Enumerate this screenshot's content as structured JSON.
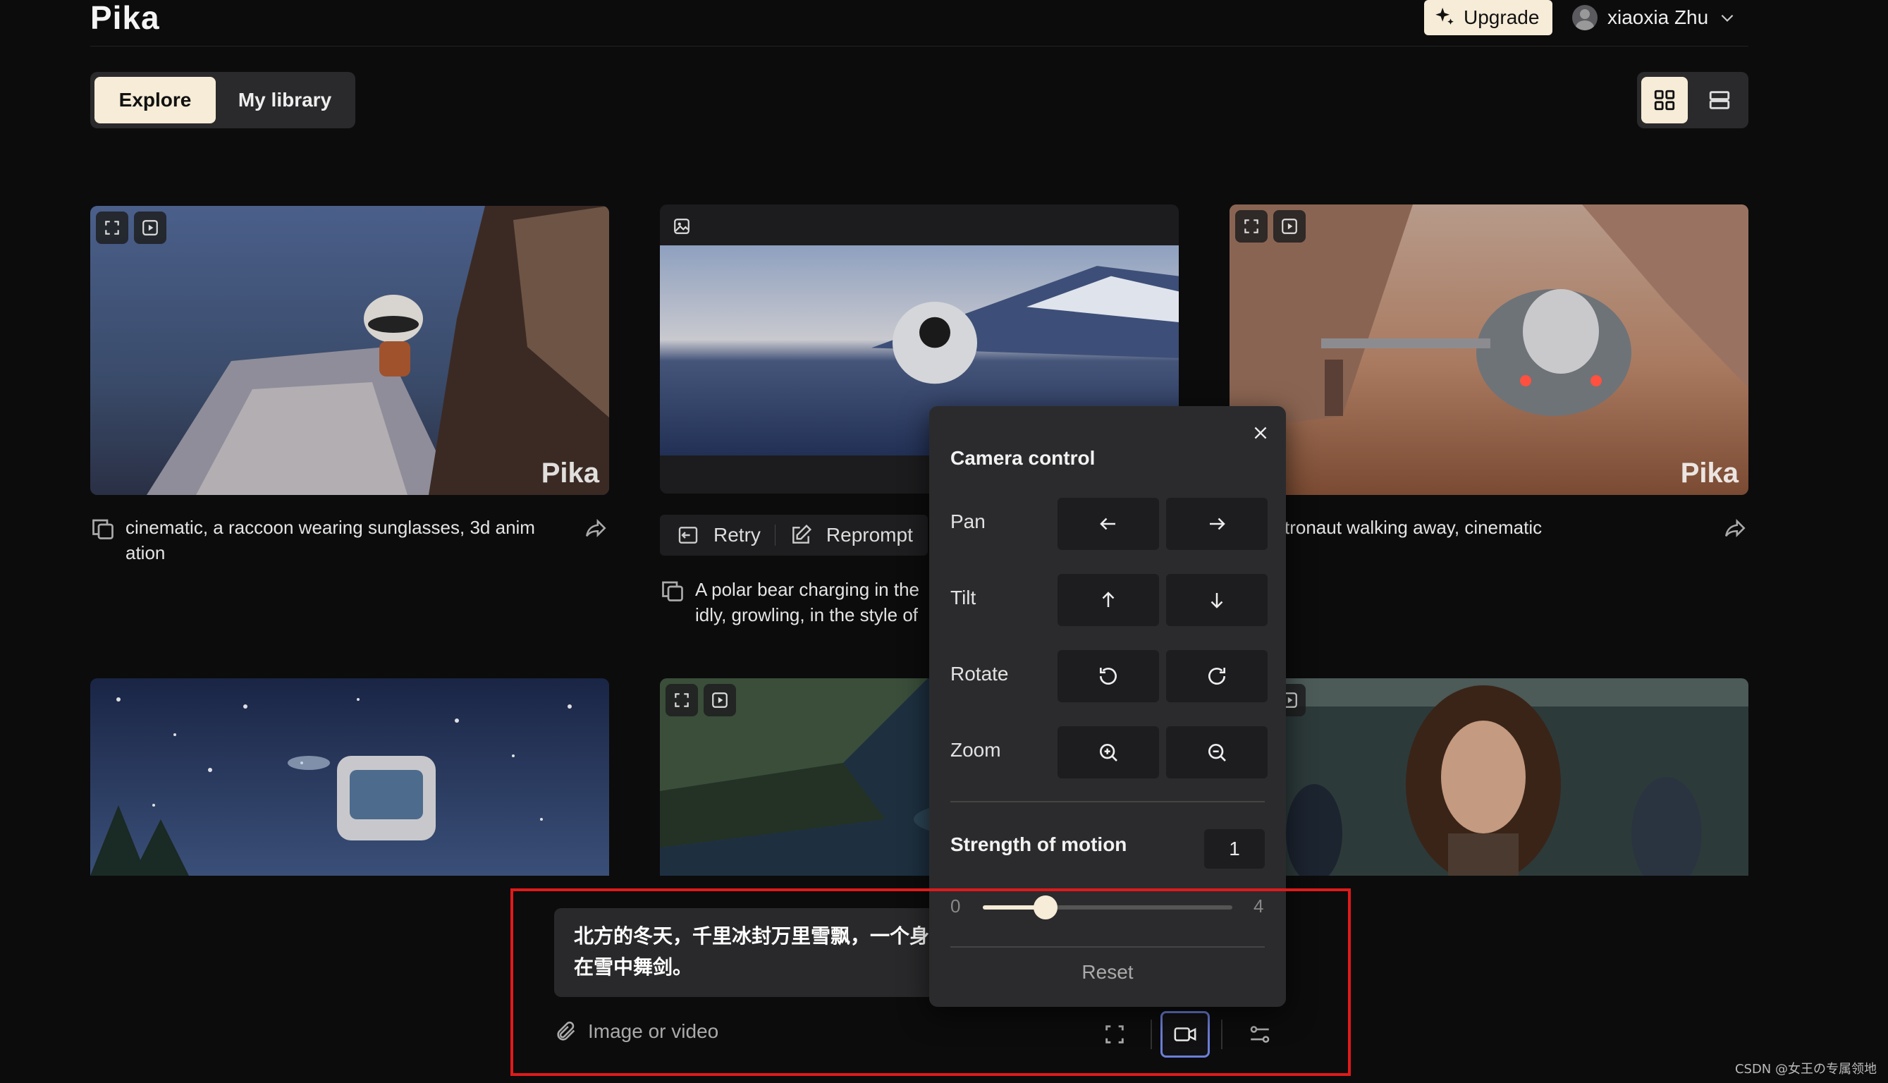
{
  "app": {
    "logo": "Pika"
  },
  "header": {
    "upgrade_label": "Upgrade",
    "user_name": "xiaoxia Zhu"
  },
  "tabs": [
    {
      "label": "Explore",
      "active": true
    },
    {
      "label": "My library",
      "active": false
    }
  ],
  "cards": [
    {
      "caption_line1": "cinematic, a raccoon wearing sunglasses, 3d anim",
      "caption_line2": "ation",
      "watermark": "Pika"
    },
    {
      "caption_line1": "A polar bear charging in the",
      "caption_line2": "idly, growling, in the style of"
    },
    {
      "caption_line1": "tronaut walking away, cinematic",
      "watermark": "Pika"
    }
  ],
  "retry_bar": {
    "retry_label": "Retry",
    "reprompt_label": "Reprompt"
  },
  "camera_control": {
    "title": "Camera control",
    "rows": [
      {
        "label": "Pan",
        "icons": [
          "arrow-left-icon",
          "arrow-right-icon"
        ]
      },
      {
        "label": "Tilt",
        "icons": [
          "arrow-up-icon",
          "arrow-down-icon"
        ]
      },
      {
        "label": "Rotate",
        "icons": [
          "rotate-ccw-icon",
          "rotate-cw-icon"
        ]
      },
      {
        "label": "Zoom",
        "icons": [
          "zoom-in-icon",
          "zoom-out-icon"
        ]
      }
    ],
    "strength_label": "Strength of motion",
    "strength_value": "1",
    "slider_min": "0",
    "slider_max": "4",
    "slider_fraction": 0.25,
    "reset_label": "Reset"
  },
  "prompt": {
    "line1": "北方的冬天，千里冰封万里雪飘，一个身",
    "line2": "在雪中舞剑。",
    "attach_label": "Image or video"
  },
  "credit": "CSDN @女王の专属领地",
  "colors": {
    "accent": "#f6ecd7",
    "highlight_border": "#e11a1a",
    "active_icon_border": "#6b7fd7"
  }
}
